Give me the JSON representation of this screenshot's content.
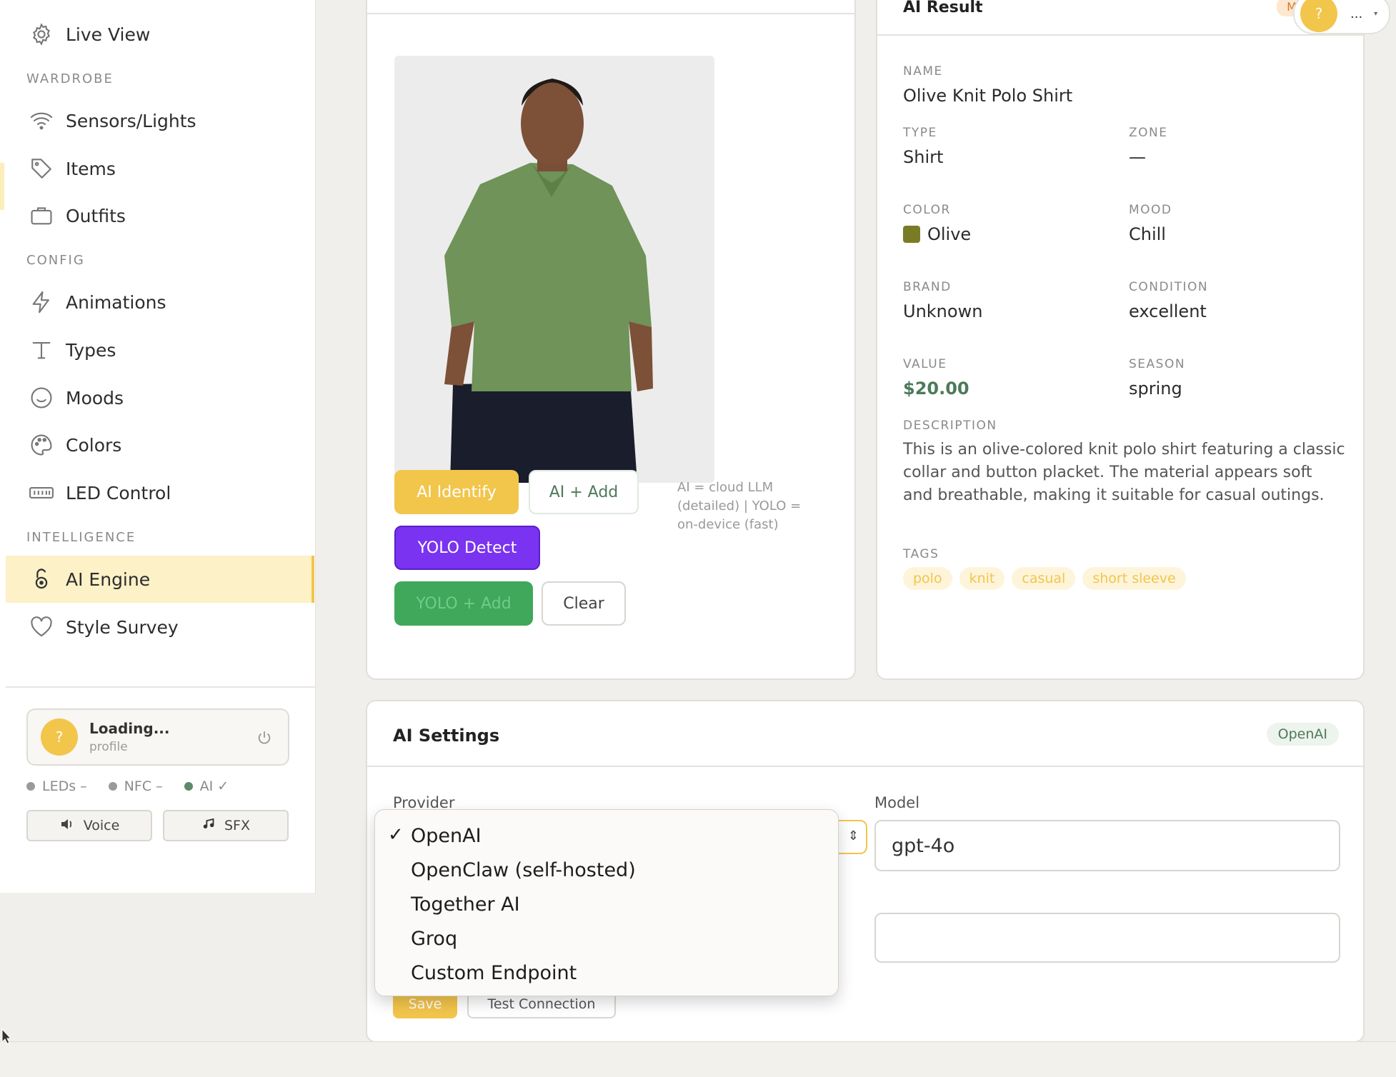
{
  "sidebar": {
    "live_view": "Live View",
    "sections": {
      "wardrobe": "WARDROBE",
      "config": "CONFIG",
      "intelligence": "INTELLIGENCE"
    },
    "items": {
      "sensors": "Sensors/Lights",
      "items": "Items",
      "outfits": "Outfits",
      "animations": "Animations",
      "types": "Types",
      "moods": "Moods",
      "colors": "Colors",
      "led_control": "LED Control",
      "ai_engine": "AI Engine",
      "style_survey": "Style Survey"
    },
    "profile": {
      "avatar": "?",
      "name": "Loading...",
      "sub": "profile"
    },
    "status": {
      "leds": "LEDs –",
      "nfc": "NFC –",
      "ai": "AI ✓"
    },
    "buttons": {
      "voice": "Voice",
      "sfx": "SFX"
    }
  },
  "image_panel": {
    "buttons": {
      "identify": "AI Identify",
      "ai_add": "AI + Add",
      "yolo_detect": "YOLO Detect",
      "yolo_add": "YOLO + Add",
      "clear": "Clear"
    },
    "help_text": "AI = cloud LLM (detailed)  |  YOLO = on-device (fast)"
  },
  "result": {
    "title": "AI Result",
    "badge": "MEL",
    "labels": {
      "name": "NAME",
      "type": "TYPE",
      "zone": "ZONE",
      "color": "COLOR",
      "mood": "MOOD",
      "brand": "BRAND",
      "condition": "CONDITION",
      "value": "VALUE",
      "season": "SEASON",
      "description": "DESCRIPTION",
      "tags": "TAGS"
    },
    "values": {
      "name": "Olive Knit Polo Shirt",
      "type": "Shirt",
      "zone": "—",
      "color": "Olive",
      "mood": "Chill",
      "brand": "Unknown",
      "condition": "excellent",
      "value": "$20.00",
      "season": "spring",
      "description": "This is an olive-colored knit polo shirt featuring a classic collar and button placket. The material appears soft and breathable, making it suitable for casual outings."
    },
    "tags": [
      "polo",
      "knit",
      "casual",
      "short sleeve"
    ],
    "color_hex": "#7a7b25"
  },
  "user_menu": {
    "avatar": "?",
    "dots": "...",
    "caret": "▾"
  },
  "settings": {
    "title": "AI Settings",
    "provider_badge": "OpenAI",
    "provider_label": "Provider",
    "model_label": "Model",
    "model_value": "gpt-4o",
    "save": "Save",
    "test": "Test Connection"
  },
  "dropdown": {
    "selected": "OpenAI",
    "options": [
      "OpenAI",
      "OpenClaw (self-hosted)",
      "Together AI",
      "Groq",
      "Custom Endpoint"
    ]
  },
  "colors": {
    "accent": "#f2c54b",
    "purple": "#7a33f0",
    "green": "#3fa85a",
    "active_bg": "#fdf1c8"
  }
}
